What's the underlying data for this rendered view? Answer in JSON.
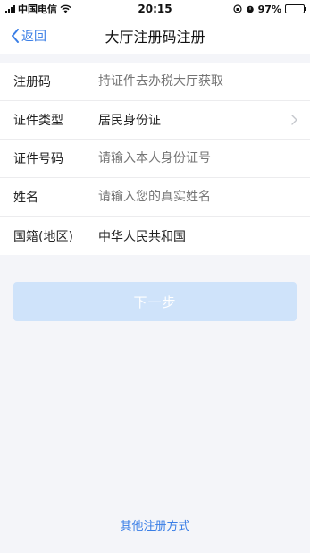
{
  "status_bar": {
    "carrier": "中国电信",
    "time": "20:15",
    "battery_percent": "97%",
    "battery_level": 0.97
  },
  "nav": {
    "back_label": "返回",
    "title": "大厅注册码注册"
  },
  "form": {
    "rows": [
      {
        "label": "注册码",
        "placeholder": "持证件去办税大厅获取"
      },
      {
        "label": "证件类型",
        "value": "居民身份证"
      },
      {
        "label": "证件号码",
        "placeholder": "请输入本人身份证号"
      },
      {
        "label": "姓名",
        "placeholder": "请输入您的真实姓名"
      },
      {
        "label": "国籍(地区)",
        "value": "中华人民共和国"
      }
    ]
  },
  "next_button": {
    "label": "下一步"
  },
  "other_methods": {
    "label": "其他注册方式"
  },
  "colors": {
    "accent": "#3a7ee6",
    "button_disabled": "#cfe3fa",
    "background": "#f4f5f9",
    "placeholder": "#bfc3c9"
  }
}
